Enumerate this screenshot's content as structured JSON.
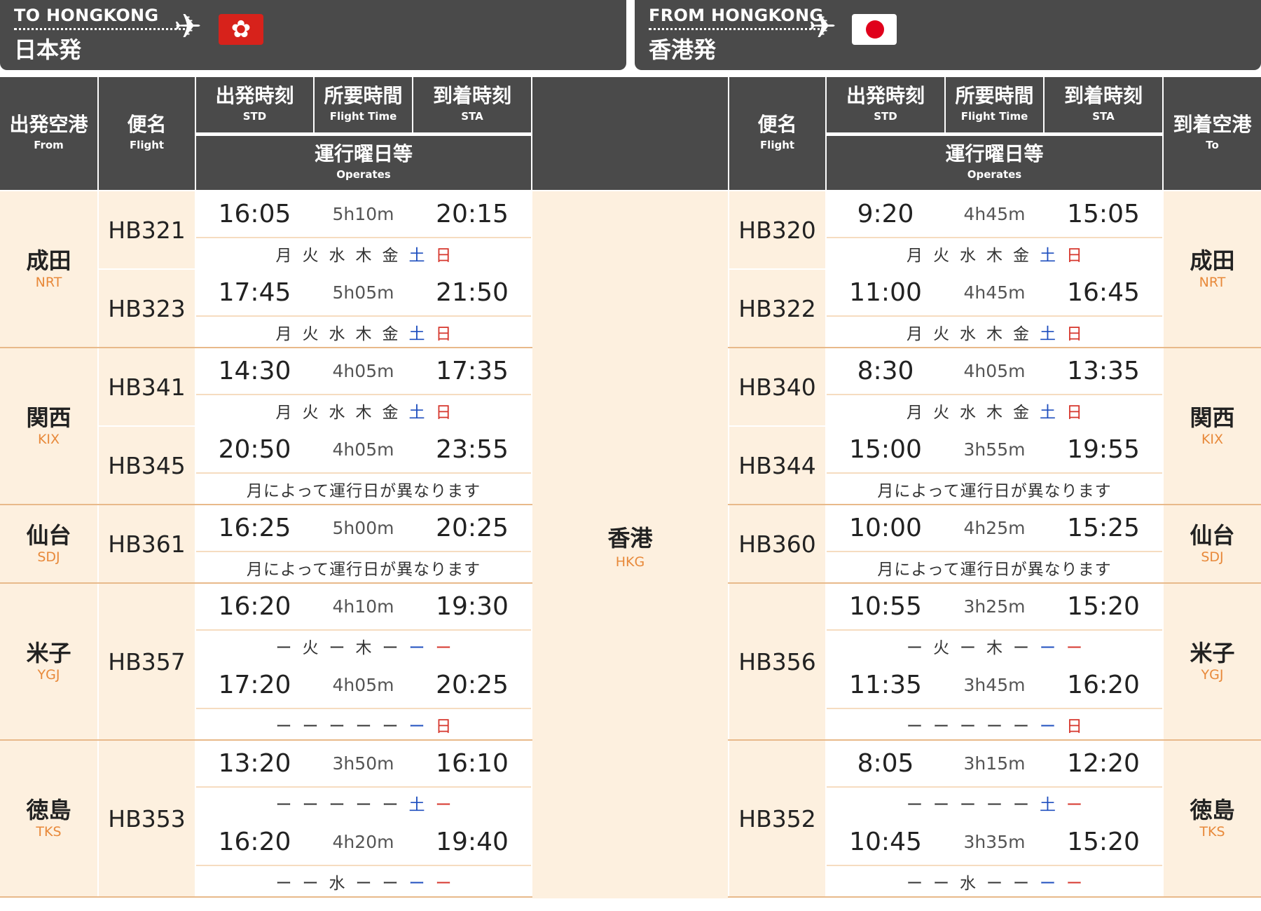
{
  "banner_to": {
    "en": "TO HONGKONG",
    "jp": "日本発"
  },
  "banner_from": {
    "en": "FROM HONGKONG",
    "jp": "香港発"
  },
  "headers": {
    "from": {
      "jp": "出発空港",
      "en": "From"
    },
    "to": {
      "jp": "到着空港",
      "en": "To"
    },
    "flight": {
      "jp": "便名",
      "en": "Flight"
    },
    "std": {
      "jp": "出発時刻",
      "en": "STD"
    },
    "fltime": {
      "jp": "所要時間",
      "en": "Flight Time"
    },
    "sta": {
      "jp": "到着時刻",
      "en": "STA"
    },
    "operates": {
      "jp": "運行曜日等",
      "en": "Operates"
    }
  },
  "hub": {
    "jp": "香港",
    "code": "HKG"
  },
  "colors": {
    "header_bg": "#4a4a4a",
    "airport_bg": "#fdf0df",
    "accent_orange": "#e8893a",
    "saturday_blue": "#1f4fbf",
    "sunday_red": "#d6362c"
  },
  "airports": [
    {
      "jp": "成田",
      "code": "NRT"
    },
    {
      "jp": "関西",
      "code": "KIX"
    },
    {
      "jp": "仙台",
      "code": "SDJ"
    },
    {
      "jp": "米子",
      "code": "YGJ"
    },
    {
      "jp": "徳島",
      "code": "TKS"
    }
  ],
  "outbound_flights": [
    "HB321",
    "HB323",
    "HB341",
    "HB345",
    "HB361",
    "HB357",
    "HB353"
  ],
  "inbound_flights": [
    "HB320",
    "HB322",
    "HB340",
    "HB344",
    "HB360",
    "HB356",
    "HB352"
  ],
  "outbound_rows": [
    {
      "std": "16:05",
      "dur": "5h10m",
      "sta": "20:15",
      "days": [
        "月",
        "火",
        "水",
        "木",
        "金",
        "土",
        "日"
      ]
    },
    {
      "std": "17:45",
      "dur": "5h05m",
      "sta": "21:50",
      "days": [
        "月",
        "火",
        "水",
        "木",
        "金",
        "土",
        "日"
      ]
    },
    {
      "std": "14:30",
      "dur": "4h05m",
      "sta": "17:35",
      "days": [
        "月",
        "火",
        "水",
        "木",
        "金",
        "土",
        "日"
      ]
    },
    {
      "std": "20:50",
      "dur": "4h05m",
      "sta": "23:55",
      "note": "月によって運行日が異なります"
    },
    {
      "std": "16:25",
      "dur": "5h00m",
      "sta": "20:25",
      "note": "月によって運行日が異なります"
    },
    {
      "std": "16:20",
      "dur": "4h10m",
      "sta": "19:30",
      "days": [
        "ー",
        "火",
        "ー",
        "木",
        "ー",
        "ー",
        "ー"
      ]
    },
    {
      "std": "17:20",
      "dur": "4h05m",
      "sta": "20:25",
      "days": [
        "ー",
        "ー",
        "ー",
        "ー",
        "ー",
        "ー",
        "日"
      ]
    },
    {
      "std": "13:20",
      "dur": "3h50m",
      "sta": "16:10",
      "days": [
        "ー",
        "ー",
        "ー",
        "ー",
        "ー",
        "土",
        "ー"
      ]
    },
    {
      "std": "16:20",
      "dur": "4h20m",
      "sta": "19:40",
      "days": [
        "ー",
        "ー",
        "水",
        "ー",
        "ー",
        "ー",
        "ー"
      ]
    }
  ],
  "inbound_rows": [
    {
      "std": "9:20",
      "dur": "4h45m",
      "sta": "15:05",
      "days": [
        "月",
        "火",
        "水",
        "木",
        "金",
        "土",
        "日"
      ]
    },
    {
      "std": "11:00",
      "dur": "4h45m",
      "sta": "16:45",
      "days": [
        "月",
        "火",
        "水",
        "木",
        "金",
        "土",
        "日"
      ]
    },
    {
      "std": "8:30",
      "dur": "4h05m",
      "sta": "13:35",
      "days": [
        "月",
        "火",
        "水",
        "木",
        "金",
        "土",
        "日"
      ]
    },
    {
      "std": "15:00",
      "dur": "3h55m",
      "sta": "19:55",
      "note": "月によって運行日が異なります"
    },
    {
      "std": "10:00",
      "dur": "4h25m",
      "sta": "15:25",
      "note": "月によって運行日が異なります"
    },
    {
      "std": "10:55",
      "dur": "3h25m",
      "sta": "15:20",
      "days": [
        "ー",
        "火",
        "ー",
        "木",
        "ー",
        "ー",
        "ー"
      ]
    },
    {
      "std": "11:35",
      "dur": "3h45m",
      "sta": "16:20",
      "days": [
        "ー",
        "ー",
        "ー",
        "ー",
        "ー",
        "ー",
        "日"
      ]
    },
    {
      "std": "8:05",
      "dur": "3h15m",
      "sta": "12:20",
      "days": [
        "ー",
        "ー",
        "ー",
        "ー",
        "ー",
        "土",
        "ー"
      ]
    },
    {
      "std": "10:45",
      "dur": "3h35m",
      "sta": "15:20",
      "days": [
        "ー",
        "ー",
        "水",
        "ー",
        "ー",
        "ー",
        "ー"
      ]
    }
  ]
}
